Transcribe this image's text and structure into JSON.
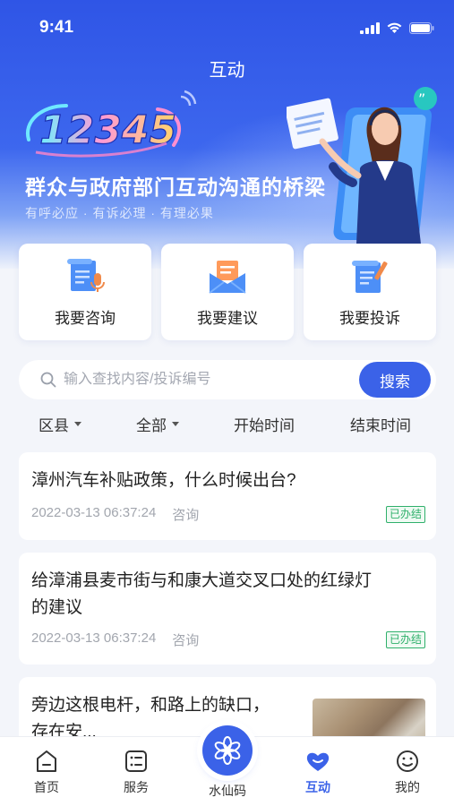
{
  "status_bar": {
    "time": "9:41"
  },
  "nav": {
    "title": "互动"
  },
  "banner": {
    "logo_text": "12345",
    "slogan": "群众与政府部门互动沟通的桥梁",
    "sub_slogan": "有呼必应 · 有诉必理 · 有理必果",
    "illustration": "customer-service-agent"
  },
  "actions": [
    {
      "label": "我要咨询",
      "icon": "consult-document-mic-icon"
    },
    {
      "label": "我要建议",
      "icon": "suggest-envelope-icon"
    },
    {
      "label": "我要投诉",
      "icon": "complain-scroll-pen-icon"
    }
  ],
  "search": {
    "placeholder": "输入查找内容/投诉编号",
    "button": "搜索"
  },
  "filters": [
    {
      "label": "区县",
      "dropdown": true
    },
    {
      "label": "全部",
      "dropdown": true
    },
    {
      "label": "开始时间",
      "dropdown": false
    },
    {
      "label": "结束时间",
      "dropdown": false
    }
  ],
  "items": [
    {
      "title": "漳州汽车补贴政策，什么时候出台?",
      "date": "2022-03-13 06:37:24",
      "type": "咨询",
      "status": "已办结"
    },
    {
      "title_lines": [
        "给漳浦县麦市街与和康大道交叉口处的红绿灯",
        "的建议"
      ],
      "date": "2022-03-13 06:37:24",
      "type": "咨询",
      "status": "已办结"
    },
    {
      "title_lines": [
        "旁边这根电杆，和路上的缺口，",
        "存在安..."
      ],
      "has_thumbnail": true
    }
  ],
  "tabbar": [
    {
      "label": "首页",
      "icon": "home-icon"
    },
    {
      "label": "服务",
      "icon": "service-grid-icon"
    },
    {
      "label": "水仙码",
      "icon": "narcissus-flower-icon"
    },
    {
      "label": "互动",
      "icon": "heart-chat-icon",
      "active": true
    },
    {
      "label": "我的",
      "icon": "smiley-face-icon"
    }
  ],
  "colors": {
    "primary": "#3b62e8",
    "success": "#2fb06b",
    "background": "#f3f5fa"
  }
}
